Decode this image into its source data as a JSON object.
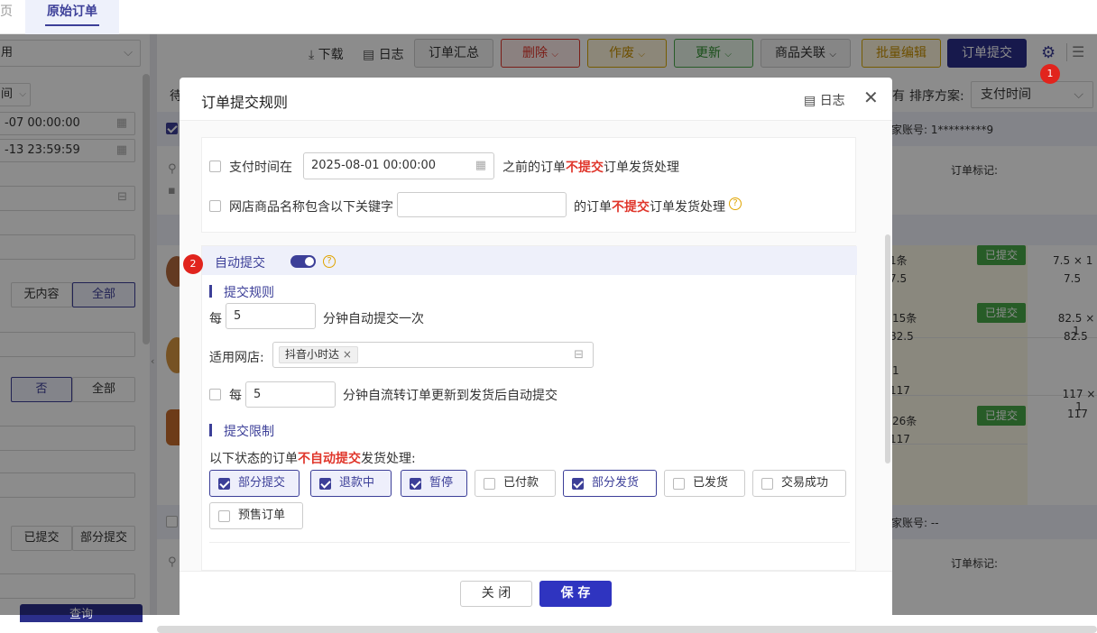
{
  "tabs": {
    "prev_tab_partial": "页",
    "active_tab": "原始订单"
  },
  "toolbar": {
    "download": "下载",
    "log": "日志",
    "summary": "订单汇总",
    "delete": "删除",
    "void": "作废",
    "update": "更新",
    "goods_link": "商品关联",
    "batch_edit": "批量编辑",
    "submit": "订单提交"
  },
  "left_panel": {
    "select_value": "用",
    "time_type": "间",
    "date_start": "-07 00:00:00",
    "date_end": "-13 23:59:59",
    "seg1": [
      "无内容",
      "全部"
    ],
    "seg2": [
      "否",
      "全部"
    ],
    "seg3": [
      "已提交",
      "部分提交"
    ],
    "query": "查询"
  },
  "list": {
    "status_partial": "待",
    "right_partial": "有",
    "sort_label": "排序方案:",
    "sort_value": "支付时间",
    "account1": "家账号:  1*********9",
    "mark_label": "订单标记:",
    "account2": "家账号:  --",
    "mark_label2": "订单标记:",
    "rows": [
      {
        "left": "1条",
        "leftv": "7.5",
        "badge": "已提交",
        "r1": "7.5 × 1",
        "r2": "7.5"
      },
      {
        "left": "15条",
        "leftv": "82.5",
        "badge": "已提交",
        "r1": "82.5 × 1",
        "r2": "82.5"
      },
      {
        "left": "1",
        "leftv": "117",
        "badge": "",
        "r1": "117 × 1",
        "r2": "117"
      },
      {
        "left": "26条",
        "leftv": "117",
        "badge": "已提交",
        "r1": "",
        "r2": ""
      }
    ]
  },
  "annotations": {
    "one": "1",
    "two": "2"
  },
  "modal": {
    "title": "订单提交规则",
    "log": "日志",
    "rule1": {
      "prefix": "支付时间在",
      "date": "2025-08-01 00:00:00",
      "mid": "之前的订单",
      "red": "不提交",
      "suffix": "订单发货处理"
    },
    "rule2": {
      "prefix": "网店商品名称包含以下关键字",
      "keyword": "",
      "mid": "的订单",
      "red": "不提交",
      "suffix": "订单发货处理"
    },
    "auto_submit": "自动提交",
    "submit_rule": "提交规则",
    "every": "每",
    "minutes": "5",
    "every_suffix": "分钟自动提交一次",
    "shop_label": "适用网店:",
    "shop_tag": "抖音小时达",
    "flow_every": "每",
    "flow_minutes": "5",
    "flow_suffix": "分钟自流转订单更新到发货后自动提交",
    "limit_title": "提交限制",
    "limit_prefix": "以下状态的订单",
    "limit_red": "不自动提交",
    "limit_suffix": "发货处理:",
    "statuses": [
      {
        "label": "部分提交",
        "checked": true
      },
      {
        "label": "退款中",
        "checked": true
      },
      {
        "label": "暂停",
        "checked": true
      },
      {
        "label": "已付款",
        "checked": false
      },
      {
        "label": "部分发货",
        "checked": true
      },
      {
        "label": "已发货",
        "checked": false
      },
      {
        "label": "交易成功",
        "checked": false
      },
      {
        "label": "预售订单",
        "checked": false
      }
    ],
    "close": "关 闭",
    "save": "保 存"
  },
  "colors": {
    "accent": "#3c3f98",
    "danger": "#e0362b",
    "success": "#48a848",
    "warn": "#d8a800"
  }
}
